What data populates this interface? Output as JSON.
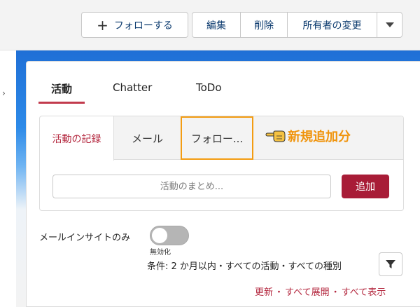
{
  "header": {
    "follow_plus": "+",
    "follow_label": "フォローする",
    "edit_label": "編集",
    "delete_label": "削除",
    "change_owner_label": "所有者の変更",
    "more_icon": "chevron-down-icon"
  },
  "left_column": {
    "marker": "›"
  },
  "tabs": [
    {
      "label": "活動",
      "active": true
    },
    {
      "label": "Chatter",
      "active": false
    },
    {
      "label": "ToDo",
      "active": false
    }
  ],
  "composer": {
    "subtabs": [
      {
        "label": "活動の記録",
        "active": true
      },
      {
        "label": "メール",
        "active": false
      },
      {
        "label": "フォロー...",
        "highlighted": true
      }
    ],
    "annotation": "新規追加分",
    "summary_placeholder": "活動のまとめ...",
    "add_label": "追加"
  },
  "insights": {
    "label": "メールインサイトのみ",
    "toggle_state": "無効化",
    "toggle_on": false
  },
  "filter": {
    "text": "条件: 2 か月以内・すべての活動・すべての種別"
  },
  "links": {
    "refresh": "更新",
    "separator": "・",
    "expand_all": "すべて展開",
    "show_all": "すべて表示"
  },
  "colors": {
    "accent": "#b4283f",
    "add_button": "#a81c37",
    "annotation": "#f0940c",
    "highlight_border": "#f39c12"
  }
}
